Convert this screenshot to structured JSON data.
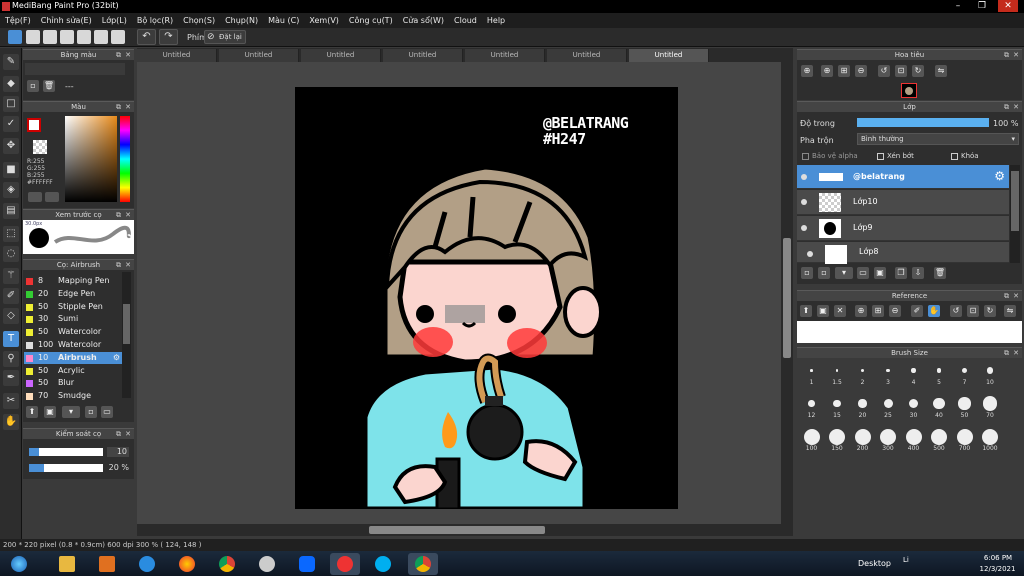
{
  "window": {
    "title": "MediBang Paint Pro (32bit)"
  },
  "menu": [
    "Tệp(F)",
    "Chỉnh sửa(E)",
    "Lớp(L)",
    "Bộ lọc(R)",
    "Chọn(S)",
    "Chụp(N)",
    "Màu (C)",
    "Xem(V)",
    "Công cụ(T)",
    "Cửa sổ(W)",
    "Cloud",
    "Help"
  ],
  "toolbar": {
    "phim": "Phím",
    "reset": "Đặt lại"
  },
  "tabs": [
    "Untitled",
    "Untitled",
    "Untitled",
    "Untitled",
    "Untitled",
    "Untitled",
    "Untitled"
  ],
  "panels": {
    "palette": "Bảng màu",
    "palette_dots": "---",
    "color": "Màu",
    "color_values": [
      "R:255",
      "G:255",
      "B:255",
      "#FFFFFF"
    ],
    "brush_preview": "Xem trước cọ",
    "brush_size_label": "30.0px",
    "brush": "Cọ: Airbrush",
    "brush_control": "Kiểm soát cọ",
    "ctrl_size": "10",
    "ctrl_opacity": "20 %",
    "navigator": "Hoa tiêu",
    "layer": "Lớp",
    "opacity_label": "Độ trong",
    "opacity_value": "100 %",
    "opacity_level": 1.0,
    "blend_label": "Pha trộn",
    "blend_value": "Bình thường",
    "protect_alpha": "Bảo vệ alpha",
    "clip": "Xén bớt",
    "lock": "Khóa",
    "reference": "Reference",
    "brush_size": "Brush Size"
  },
  "brushes": [
    {
      "size": "8",
      "name": "Mapping Pen",
      "color": "#e33"
    },
    {
      "size": "20",
      "name": "Edge Pen",
      "color": "#3c3"
    },
    {
      "size": "50",
      "name": "Stipple Pen",
      "color": "#ee3"
    },
    {
      "size": "30",
      "name": "Sumi",
      "color": "#ee3"
    },
    {
      "size": "50",
      "name": "Watercolor",
      "color": "#ee3"
    },
    {
      "size": "100",
      "name": "Watercolor (Wet)",
      "color": "#ddd"
    },
    {
      "size": "10",
      "name": "Airbrush",
      "color": "#f8c",
      "selected": true
    },
    {
      "size": "50",
      "name": "Acrylic",
      "color": "#ee3"
    },
    {
      "size": "50",
      "name": "Blur",
      "color": "#c6f"
    },
    {
      "size": "70",
      "name": "Smudge",
      "color": "#fdb"
    }
  ],
  "layers": [
    {
      "name": "@belatrang",
      "selected": true
    },
    {
      "name": "Lớp10"
    },
    {
      "name": "Lớp9"
    },
    {
      "name": "Lớp8"
    }
  ],
  "brush_sizes": [
    "1",
    "1.5",
    "2",
    "3",
    "4",
    "5",
    "7",
    "10",
    "12",
    "15",
    "20",
    "25",
    "30",
    "40",
    "50",
    "70",
    "100",
    "150",
    "200",
    "300",
    "400",
    "500",
    "700",
    "1000"
  ],
  "canvas": {
    "watermark_line1": "@BELATRANG",
    "watermark_line2": "#H247"
  },
  "status": "200 * 220 pixel   (0.8 * 0.9cm)   600 dpi   300 %   ( 124, 148 )",
  "taskbar": {
    "desktop": "Desktop",
    "time": "6:06 PM",
    "date": "12/3/2021",
    "lang": "Li"
  }
}
